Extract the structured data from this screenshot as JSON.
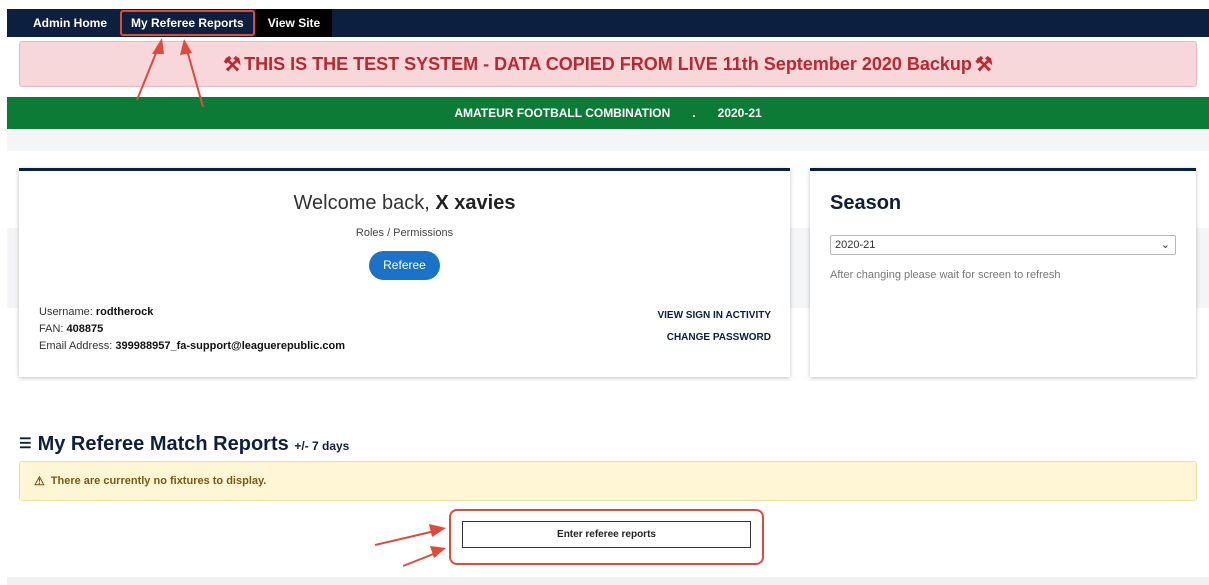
{
  "nav": {
    "items": [
      {
        "label": "Admin Home"
      },
      {
        "label": "My Referee Reports"
      },
      {
        "label": "View Site"
      }
    ]
  },
  "test_banner": {
    "text": "THIS IS THE TEST SYSTEM - DATA COPIED FROM LIVE 11th September 2020 Backup",
    "icon": "tools-icon"
  },
  "league_bar": {
    "name": "AMATEUR FOOTBALL COMBINATION",
    "separator": ".",
    "season": "2020-21"
  },
  "welcome": {
    "prefix": "Welcome back, ",
    "user": "X xavies",
    "roles_label": "Roles / Permissions",
    "role": "Referee",
    "username_label": "Username: ",
    "username": "rodtherock",
    "fan_label": "FAN: ",
    "fan": "408875",
    "email_label": "Email Address: ",
    "email": "399988957_fa-support@leaguerepublic.com",
    "link_activity": "VIEW SIGN IN ACTIVITY",
    "link_password": "CHANGE PASSWORD"
  },
  "season": {
    "title": "Season",
    "selected": "2020-21",
    "hint": "After changing please wait for screen to refresh"
  },
  "reports": {
    "title": "My Referee Match Reports",
    "subtitle": "+/- 7 days",
    "alert": "There are currently no fixtures to display.",
    "button": "Enter referee reports"
  },
  "colors": {
    "nav_bg": "#0c1f3f",
    "green_bar": "#0b7b35",
    "banner_text": "#c0262d",
    "pill": "#1a73c9",
    "annotation": "#e04a3a"
  }
}
